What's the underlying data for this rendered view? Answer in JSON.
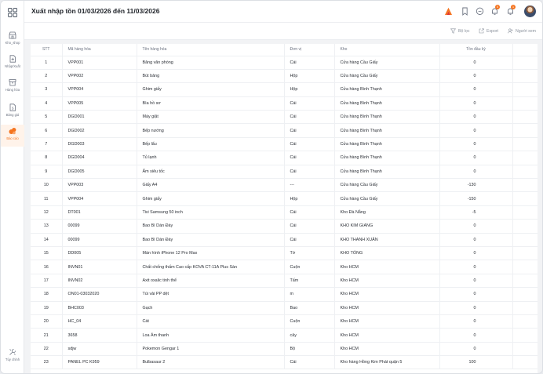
{
  "header": {
    "title": "Xuất nhập tồn 01/03/2026 đến 11/03/2026",
    "badge_1": "0",
    "badge_2": "1"
  },
  "sidebar": {
    "items": [
      {
        "label": "Kho_shop",
        "icon": "store-icon"
      },
      {
        "label": "Nhập/Xuất",
        "icon": "import-export-icon"
      },
      {
        "label": "Hàng hóa",
        "icon": "box-icon"
      },
      {
        "label": "Bảng giá",
        "icon": "price-list-icon"
      },
      {
        "label": "Báo cáo",
        "icon": "report-icon"
      }
    ],
    "settings_label": "Tùy chỉnh"
  },
  "toolbar": {
    "filter_label": "Bộ lọc",
    "export_label": "Export",
    "viewer_label": "Người xem"
  },
  "table": {
    "columns": {
      "stt": "STT",
      "code": "Mã hàng hóa",
      "name": "Tên hàng hóa",
      "unit": "Đơn vị",
      "store": "Kho",
      "opening": "Tồn đầu kỳ"
    },
    "rows": [
      {
        "stt": "1",
        "code": "VPP001",
        "name": "Băng văn phòng",
        "unit": "Cái",
        "store": "Cửa hàng Cầu Giấy",
        "opening": "0"
      },
      {
        "stt": "2",
        "code": "VPP002",
        "name": "Bút bảng",
        "unit": "Hộp",
        "store": "Cửa hàng Cầu Giấy",
        "opening": "0"
      },
      {
        "stt": "3",
        "code": "VPP004",
        "name": "Ghim giấy",
        "unit": "Hộp",
        "store": "Cửa hàng Bình Thạnh",
        "opening": "0"
      },
      {
        "stt": "4",
        "code": "VPP005",
        "name": "Bìa hồ sơ",
        "unit": "Cái",
        "store": "Cửa hàng Bình Thạnh",
        "opening": "0"
      },
      {
        "stt": "5",
        "code": "DGD001",
        "name": "Máy giặt",
        "unit": "Cái",
        "store": "Cửa hàng Bình Thạnh",
        "opening": "0"
      },
      {
        "stt": "6",
        "code": "DGD002",
        "name": "Bếp nướng",
        "unit": "Cái",
        "store": "Cửa hàng Bình Thạnh",
        "opening": "0"
      },
      {
        "stt": "7",
        "code": "DGD003",
        "name": "Bếp lẩu",
        "unit": "Cái",
        "store": "Cửa hàng Bình Thạnh",
        "opening": "0"
      },
      {
        "stt": "8",
        "code": "DGD004",
        "name": "Tủ lạnh",
        "unit": "Cái",
        "store": "Cửa hàng Bình Thạnh",
        "opening": "0"
      },
      {
        "stt": "9",
        "code": "DGD005",
        "name": "Ấm siêu tốc",
        "unit": "Cái",
        "store": "Cửa hàng Bình Thạnh",
        "opening": "0"
      },
      {
        "stt": "10",
        "code": "VPP003",
        "name": "Giấy A4",
        "unit": "---",
        "store": "Cửa hàng Cầu Giấy",
        "opening": "-130"
      },
      {
        "stt": "11",
        "code": "VPP004",
        "name": "Ghim giấy",
        "unit": "Hộp",
        "store": "Cửa hàng Cầu Giấy",
        "opening": "-150"
      },
      {
        "stt": "12",
        "code": "DT001",
        "name": "Tivi Samsung 50 inch",
        "unit": "Cái",
        "store": "Kho Đà Nẵng",
        "opening": "-5"
      },
      {
        "stt": "13",
        "code": "00099",
        "name": "Bao Bì Dán Đáy",
        "unit": "Cái",
        "store": "KHO KIM GIANG",
        "opening": "0"
      },
      {
        "stt": "14",
        "code": "00099",
        "name": "Bao Bì Dán Đáy",
        "unit": "Cái",
        "store": "KHO THANH XUÂN",
        "opening": "0"
      },
      {
        "stt": "15",
        "code": "DD005",
        "name": "Màn hình iPhone 12 Pro Max",
        "unit": "Tờ",
        "store": "KHO TỔNG",
        "opening": "0"
      },
      {
        "stt": "16",
        "code": "INVN01",
        "name": "Chất chống thấm Cao cấp KOVA CT-11A Plus Sàn",
        "unit": "Cuộn",
        "store": "Kho HCM",
        "opening": "0"
      },
      {
        "stt": "17",
        "code": "INVN02",
        "name": "Axit oxalic tinh thể",
        "unit": "Tấm",
        "store": "Kho HCM",
        "opening": "0"
      },
      {
        "stt": "18",
        "code": "ON01-03032020",
        "name": "Túi vải PP dệt",
        "unit": "m",
        "store": "Kho HCM",
        "opening": "0"
      },
      {
        "stt": "19",
        "code": "BHC003",
        "name": "Gạch",
        "unit": "Bao",
        "store": "Kho HCM",
        "opening": "0"
      },
      {
        "stt": "20",
        "code": "HC_04",
        "name": "Cát",
        "unit": "Cuộn",
        "store": "Kho HCM",
        "opening": "0"
      },
      {
        "stt": "21",
        "code": "3658",
        "name": "Loa Âm thanh",
        "unit": "cây",
        "store": "Kho HCM",
        "opening": "0"
      },
      {
        "stt": "22",
        "code": "sdjw",
        "name": "Pokemon Gengar 1",
        "unit": "Bộ",
        "store": "Kho HCM",
        "opening": "0"
      },
      {
        "stt": "23",
        "code": "PANEL PC K959",
        "name": "Bulbasaur 2",
        "unit": "Cái",
        "store": "Kho hàng Hồng Kim Phát quận 5",
        "opening": "100"
      }
    ]
  }
}
